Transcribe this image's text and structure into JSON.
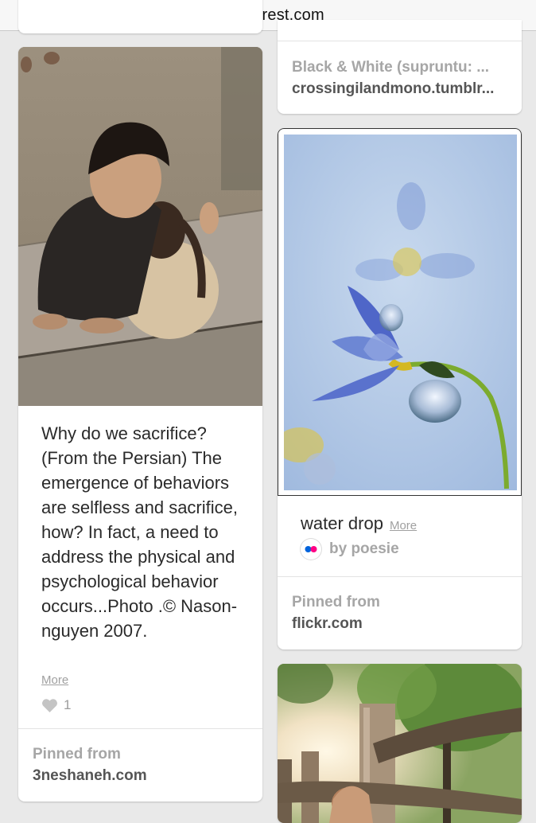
{
  "browser": {
    "url": "pinterest.com",
    "lock_icon": "lock-icon"
  },
  "colors": {
    "background": "#e9e9e9",
    "card": "#ffffff",
    "label_gray": "#a6a6a6",
    "source_dark": "#555555",
    "flickr_pink": "#ff0084",
    "flickr_blue": "#0063dc"
  },
  "pins": {
    "left_top": {},
    "left": {
      "image": "children-embracing-photo",
      "description": "Why do we sacrifice? (From the Persian) The emergence of behaviors are selfless and sacrifice, how? In fact, a need to address the physical and psychological behavior occurs...Photo .© Nason-nguyen 2007.",
      "more_label": "More",
      "like_icon": "heart-icon",
      "like_count": "1",
      "pinned_label": "Pinned from",
      "pinned_source": "3neshaneh.com"
    },
    "right_top": {
      "title": "Black & White (supruntu: ...",
      "source": "crossingilandmono.tumblr..."
    },
    "right_middle": {
      "image": "blue-flower-water-drop-photo",
      "title": "water drop",
      "more_label": "More",
      "provider_icon": "flickr-icon",
      "provider_text": "by poesie",
      "pinned_label": "Pinned from",
      "pinned_source": "flickr.com"
    },
    "right_bottom": {
      "image": "sunlit-fence-girl-photo"
    }
  }
}
